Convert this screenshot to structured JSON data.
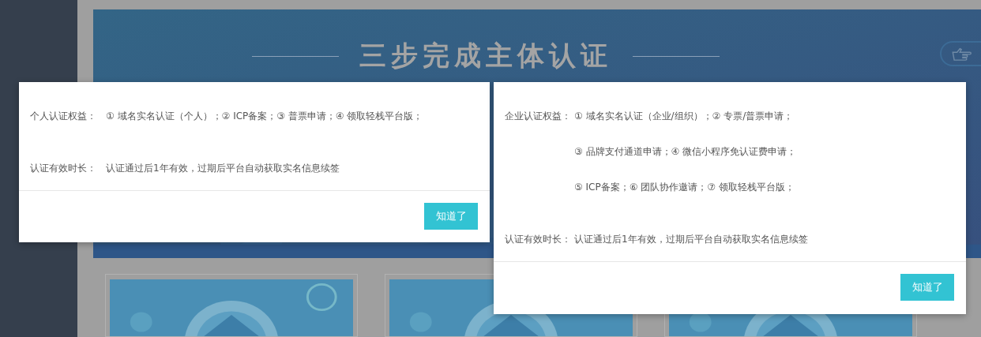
{
  "banner": {
    "title": "三步完成主体认证"
  },
  "dialogs": [
    {
      "benefits_label": "个人认证权益：",
      "benefits": [
        "① 域名实名认证（个人）；② ICP备案；③ 普票申请；④ 领取轻栈平台版；"
      ],
      "validity_label": "认证有效时长：",
      "validity": "认证通过后1年有效，过期后平台自动获取实名信息续签",
      "button": "知道了"
    },
    {
      "benefits_label": "企业认证权益：",
      "benefits": [
        "① 域名实名认证（企业/组织）；② 专票/普票申请；",
        "③ 品牌支付通道申请；④ 微信小程序免认证费申请；",
        "⑤ ICP备案；⑥ 团队协作邀请；⑦ 领取轻栈平台版；"
      ],
      "validity_label": "认证有效时长：",
      "validity": "认证通过后1年有效，过期后平台自动获取实名信息续签",
      "button": "知道了"
    }
  ]
}
